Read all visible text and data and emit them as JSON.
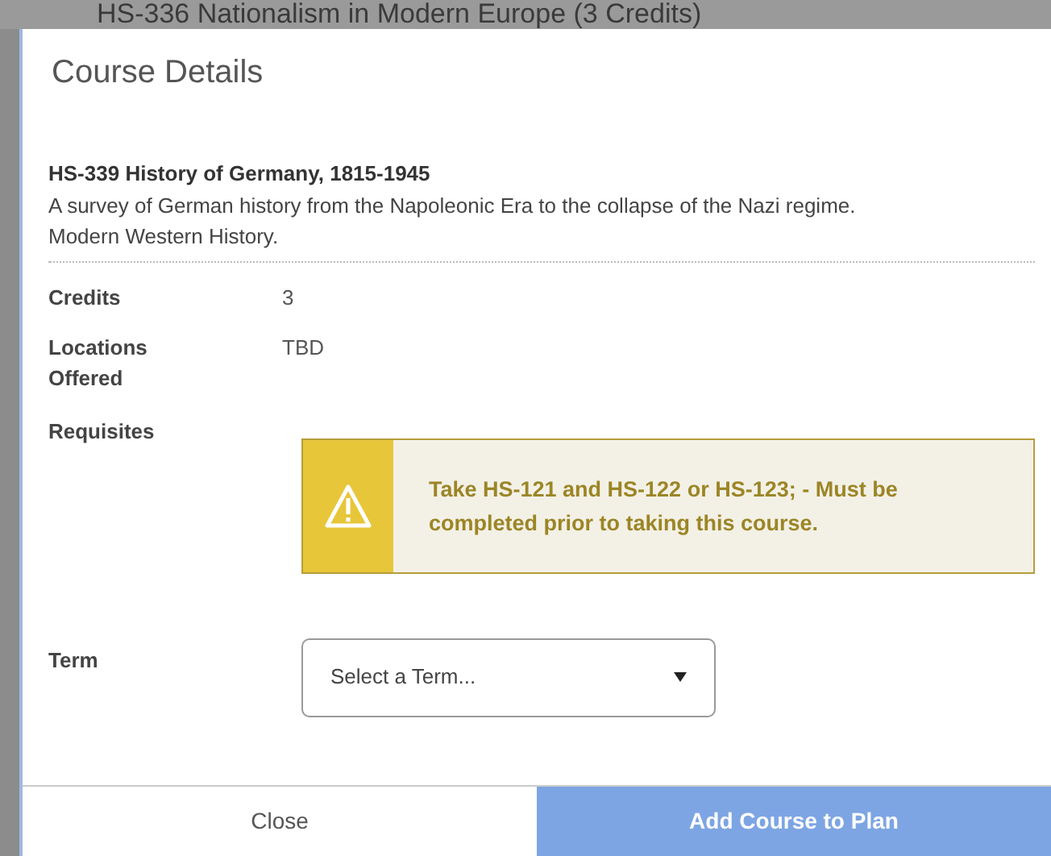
{
  "background": {
    "course_heading": "HS-336 Nationalism in Modern Europe (3 Credits)"
  },
  "dialog": {
    "title": "Course Details",
    "course_title": "HS-339 History of Germany, 1815-1945",
    "description": "A survey of German history from the Napoleonic Era to the collapse of the Nazi regime. Modern Western History.",
    "fields": [
      {
        "label": "Credits",
        "value": "3"
      },
      {
        "label": "Locations Offered",
        "value": "TBD"
      }
    ],
    "requisites": {
      "label": "Requisites",
      "warning": "Take HS-121 and HS-122 or HS-123; - Must be completed prior to taking this course."
    },
    "term": {
      "label": "Term",
      "placeholder": "Select a Term..."
    },
    "buttons": [
      {
        "label": "Close",
        "kind": "secondary"
      },
      {
        "label": "Add Course to Plan",
        "kind": "primary"
      }
    ]
  }
}
